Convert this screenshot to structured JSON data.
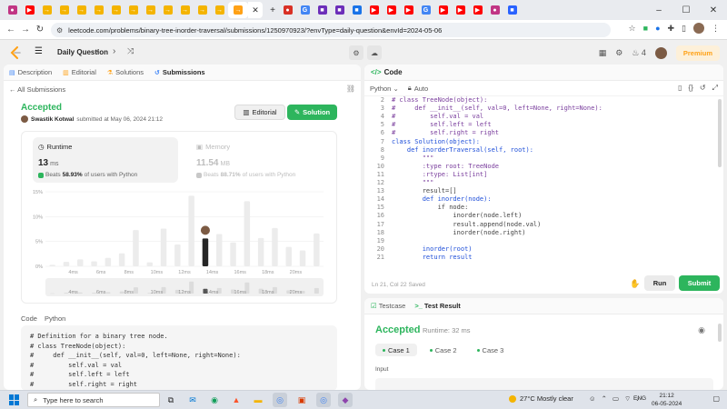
{
  "browser": {
    "tabs": [
      {
        "icon": "instagram-icon",
        "glyph": "●",
        "color": "#c13584"
      },
      {
        "icon": "youtube-icon",
        "glyph": "▶",
        "color": "#ff0000"
      },
      {
        "icon": "pdf-icon",
        "glyph": "→",
        "color": "#f4b400"
      },
      {
        "icon": "pdf-icon",
        "glyph": "→",
        "color": "#f4b400"
      },
      {
        "icon": "pdf-icon",
        "glyph": "→",
        "color": "#f4b400"
      },
      {
        "icon": "pdf-icon",
        "glyph": "→",
        "color": "#f4b400"
      },
      {
        "icon": "pdf-icon",
        "glyph": "→",
        "color": "#f4b400"
      },
      {
        "icon": "pdf-icon",
        "glyph": "→",
        "color": "#f4b400"
      },
      {
        "icon": "pdf-icon",
        "glyph": "→",
        "color": "#f4b400"
      },
      {
        "icon": "pdf-icon",
        "glyph": "→",
        "color": "#f4b400"
      },
      {
        "icon": "pdf-icon",
        "glyph": "→",
        "color": "#f4b400"
      },
      {
        "icon": "pdf-icon",
        "glyph": "→",
        "color": "#f4b400"
      },
      {
        "icon": "pdf-icon",
        "glyph": "→",
        "color": "#f4b400"
      },
      {
        "icon": "leetcode-icon",
        "glyph": "→",
        "color": "#ffa116",
        "active": true
      }
    ],
    "tabs_right": [
      {
        "icon": "record-icon",
        "glyph": "●",
        "color": "#d93025"
      },
      {
        "icon": "google-icon",
        "glyph": "G",
        "color": "#4285f4"
      },
      {
        "icon": "app-icon",
        "glyph": "■",
        "color": "#6c2eb9"
      },
      {
        "icon": "app-icon",
        "glyph": "■",
        "color": "#6c2eb9"
      },
      {
        "icon": "bookmark-icon",
        "glyph": "■",
        "color": "#1a73e8"
      },
      {
        "icon": "youtube-icon",
        "glyph": "▶",
        "color": "#ff0000"
      },
      {
        "icon": "youtube-icon",
        "glyph": "▶",
        "color": "#ff0000"
      },
      {
        "icon": "youtube-icon",
        "glyph": "▶",
        "color": "#ff0000"
      },
      {
        "icon": "google-icon",
        "glyph": "G",
        "color": "#4285f4"
      },
      {
        "icon": "youtube-icon",
        "glyph": "▶",
        "color": "#ff0000"
      },
      {
        "icon": "youtube-icon",
        "glyph": "▶",
        "color": "#ff0000"
      },
      {
        "icon": "youtube-icon",
        "glyph": "▶",
        "color": "#ff0000"
      },
      {
        "icon": "instagram-icon",
        "glyph": "●",
        "color": "#c13584"
      },
      {
        "icon": "hashnode-icon",
        "glyph": "■",
        "color": "#2962ff"
      }
    ],
    "url": "leetcode.com/problems/binary-tree-inorder-traversal/submissions/1250970923/?envType=daily-question&envId=2024-05-06"
  },
  "header": {
    "daily_question": "Daily Question",
    "streak_count": "4",
    "premium_label": "Premium"
  },
  "left": {
    "tabs": {
      "description": "Description",
      "editorial": "Editorial",
      "solutions": "Solutions",
      "submissions": "Submissions"
    },
    "all_submissions": "All Submissions",
    "status": "Accepted",
    "username": "Swastik Kotwal",
    "submitted_at": "submitted at May 06, 2024 21:12",
    "editorial_btn": "Editorial",
    "solution_btn": "Solution",
    "runtime": {
      "label": "Runtime",
      "value": "13",
      "unit": "ms",
      "beats_pct": "58.93%",
      "beats_suffix": "of users with Python",
      "beats_prefix": "Beats"
    },
    "memory": {
      "label": "Memory",
      "value": "11.54",
      "unit": "MB",
      "beats_pct": "88.71%",
      "beats_suffix": "of users with Python",
      "beats_prefix": "Beats"
    },
    "code_label": "Code",
    "code_lang": "Python",
    "code_lines": [
      "# Definition for a binary tree node.",
      "# class TreeNode(object):",
      "#     def __init__(self, val=0, left=None, right=None):",
      "#         self.val = val",
      "#         self.left = left",
      "#         self.right = right"
    ]
  },
  "chart_data": {
    "type": "bar",
    "y_ticks": [
      "15%",
      "10%",
      "5%",
      "0%"
    ],
    "ylim": [
      0,
      15
    ],
    "x_tick_labels": [
      "4ms",
      "6ms",
      "8ms",
      "10ms",
      "12ms",
      "14ms",
      "16ms",
      "18ms",
      "20ms"
    ],
    "bars": [
      0.3,
      0.9,
      1.4,
      1.0,
      1.7,
      2.6,
      7.3,
      0.8,
      7.6,
      4.4,
      14.2,
      5.6,
      6.5,
      4.8,
      13.1,
      5.7,
      7.7,
      3.9,
      3.2,
      6.6
    ],
    "highlight_index": 11,
    "brush_labels": [
      "4ms",
      "6ms",
      "8ms",
      "10ms",
      "12ms",
      "14ms",
      "16ms",
      "18ms",
      "20ms"
    ]
  },
  "code_panel": {
    "title": "Code",
    "language": "Python",
    "auto": "Auto",
    "lines": [
      {
        "n": "2",
        "t": "# class TreeNode(object):"
      },
      {
        "n": "3",
        "t": "#     def __init__(self, val=0, left=None, right=None):"
      },
      {
        "n": "4",
        "t": "#         self.val = val"
      },
      {
        "n": "5",
        "t": "#         self.left = left"
      },
      {
        "n": "6",
        "t": "#         self.right = right"
      },
      {
        "n": "7",
        "t": "class Solution(object):"
      },
      {
        "n": "8",
        "t": "    def inorderTraversal(self, root):"
      },
      {
        "n": "9",
        "t": "        \"\"\""
      },
      {
        "n": "10",
        "t": "        :type root: TreeNode"
      },
      {
        "n": "11",
        "t": "        :rtype: List[int]"
      },
      {
        "n": "12",
        "t": "        \"\"\""
      },
      {
        "n": "13",
        "t": "        result=[]"
      },
      {
        "n": "14",
        "t": "        def inorder(node):"
      },
      {
        "n": "15",
        "t": "            if node:"
      },
      {
        "n": "16",
        "t": "                inorder(node.left)"
      },
      {
        "n": "17",
        "t": "                result.append(node.val)"
      },
      {
        "n": "18",
        "t": "                inorder(node.right)"
      },
      {
        "n": "19",
        "t": ""
      },
      {
        "n": "20",
        "t": "        inorder(root)"
      },
      {
        "n": "21",
        "t": "        return result"
      }
    ],
    "status": "Ln 21, Col 22    Saved",
    "run_label": "Run",
    "submit_label": "Submit"
  },
  "result_panel": {
    "testcase_tab": "Testcase",
    "result_tab": "Test Result",
    "status": "Accepted",
    "runtime": "Runtime: 32 ms",
    "cases": [
      "Case 1",
      "Case 2",
      "Case 3"
    ],
    "input_label": "Input"
  },
  "taskbar": {
    "search_placeholder": "Type here to search",
    "weather": "27°C  Mostly clear",
    "lang": "ENG",
    "time": "21:12",
    "date": "06-05-2024"
  }
}
